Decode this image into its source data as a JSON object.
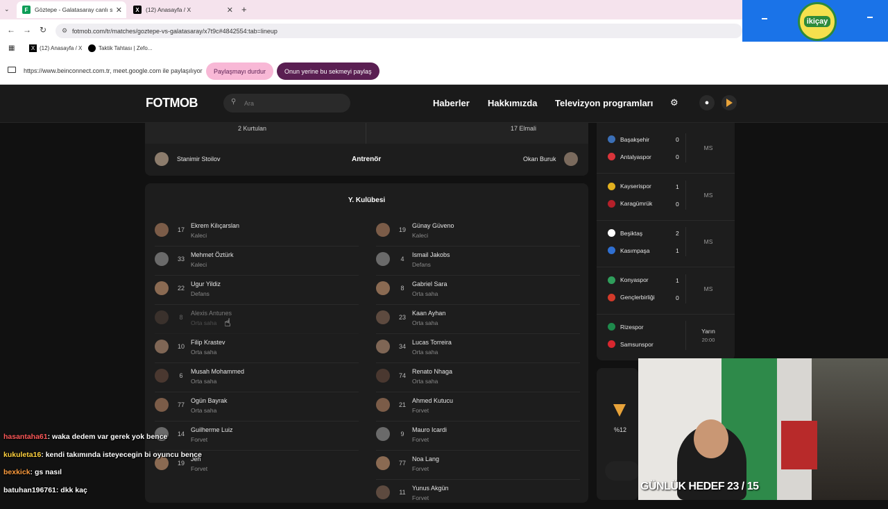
{
  "browser": {
    "tabs": [
      {
        "title": "Göztepe - Galatasaray canlı skor",
        "active": true
      },
      {
        "title": "(12) Anasayfa / X",
        "active": false
      }
    ],
    "new_tab": "+",
    "url": "fotmob.com/tr/matches/goztepe-vs-galatasaray/x7t9c#4842554:tab=lineup",
    "bookmarks": [
      "(12) Anasayfa / X",
      "Taktik Tahtası | Zefo..."
    ],
    "share_text": "https://www.beinconnect.com.tr, meet.google.com ile paylaşılıyor",
    "stop_sharing": "Paylaşmayı durdur",
    "share_this_tab": "Onun yerine bu sekmeyi paylaş"
  },
  "overlay_logo": "ikiçay",
  "fotmob": {
    "logo": "FOTMOB",
    "search_placeholder": "Ara",
    "nav": [
      "Haberler",
      "Hakkımızda",
      "Televizyon programları"
    ]
  },
  "coach_card": {
    "stat_left": "2 Kurtulan",
    "stat_right": "17 Elmali",
    "coach_home": "Stanimir Stoilov",
    "label": "Antrenör",
    "coach_away": "Okan Buruk"
  },
  "bench": {
    "title": "Y. Kulübesi",
    "home": [
      {
        "num": "17",
        "name": "Ekrem Kilıçarslan",
        "pos": "Kaleci",
        "faded": false
      },
      {
        "num": "33",
        "name": "Mehmet Öztürk",
        "pos": "Kaleci",
        "faded": false
      },
      {
        "num": "22",
        "name": "Ugur Yildiz",
        "pos": "Defans",
        "faded": false
      },
      {
        "num": "8",
        "name": "Alexis Antunes",
        "pos": "Orta saha",
        "faded": true
      },
      {
        "num": "10",
        "name": "Filip Krastev",
        "pos": "Orta saha",
        "faded": false
      },
      {
        "num": "6",
        "name": "Musah Mohammed",
        "pos": "Orta saha",
        "faded": false
      },
      {
        "num": "77",
        "name": "Ogün Bayrak",
        "pos": "Orta saha",
        "faded": false
      },
      {
        "num": "14",
        "name": "Guilherme Luiz",
        "pos": "Forvet",
        "faded": false
      },
      {
        "num": "19",
        "name": "Jeh",
        "pos": "Forvet",
        "faded": false
      }
    ],
    "away": [
      {
        "num": "19",
        "name": "Günay Güveno",
        "pos": "Kaleci"
      },
      {
        "num": "4",
        "name": "Ismail Jakobs",
        "pos": "Defans"
      },
      {
        "num": "8",
        "name": "Gabriel Sara",
        "pos": "Orta saha"
      },
      {
        "num": "23",
        "name": "Kaan Ayhan",
        "pos": "Orta saha"
      },
      {
        "num": "34",
        "name": "Lucas Torreira",
        "pos": "Orta saha"
      },
      {
        "num": "74",
        "name": "Renato Nhaga",
        "pos": "Orta saha"
      },
      {
        "num": "21",
        "name": "Ahmed Kutucu",
        "pos": "Forvet"
      },
      {
        "num": "9",
        "name": "Mauro Icardi",
        "pos": "Forvet"
      },
      {
        "num": "77",
        "name": "Noa Lang",
        "pos": "Forvet"
      },
      {
        "num": "11",
        "name": "Yunus Akgün",
        "pos": "Forvet"
      }
    ]
  },
  "fixtures": [
    {
      "home": "Başakşehir",
      "home_score": "0",
      "away": "Antalyaspor",
      "away_score": "0",
      "status": "MS",
      "home_color": "#3b6fb6",
      "away_color": "#d9343a"
    },
    {
      "home": "Kayserispor",
      "home_score": "1",
      "away": "Karagümrük",
      "away_score": "0",
      "status": "MS",
      "home_color": "#e2b11f",
      "away_color": "#b5202a"
    },
    {
      "home": "Beşiktaş",
      "home_score": "2",
      "away": "Kasımpaşa",
      "away_score": "1",
      "status": "MS",
      "home_color": "#ffffff",
      "away_color": "#2f6fd1"
    },
    {
      "home": "Konyaspor",
      "home_score": "1",
      "away": "Gençlerbirliği",
      "away_score": "0",
      "status": "MS",
      "home_color": "#2f9e5b",
      "away_color": "#d23a2a"
    },
    {
      "home": "Rizespor",
      "home_score": "",
      "away": "Samsunspor",
      "away_score": "",
      "status": "Yarın",
      "time": "20:00",
      "home_color": "#1e8a4c",
      "away_color": "#d8272f"
    }
  ],
  "probability": "%12",
  "chat": [
    {
      "user": "hasantaha61",
      "msg": ": waka dedem var gerek yok bence"
    },
    {
      "user": "kukuleta16",
      "msg": ": kendi takımında isteyecegin bi oyuncu bence"
    },
    {
      "user": "bexkick",
      "msg": ": gs nasıl"
    },
    {
      "user": "batuhan196761",
      "msg": ": dkk kaç"
    }
  ],
  "webcam_banner": "GÜNLÜK HEDEF 23 / 15",
  "colors": {
    "accent_pink": "#f8b8d6",
    "accent_purple": "#5a1f52",
    "dark_bg": "#111111",
    "card_bg": "#1d1d1d"
  }
}
